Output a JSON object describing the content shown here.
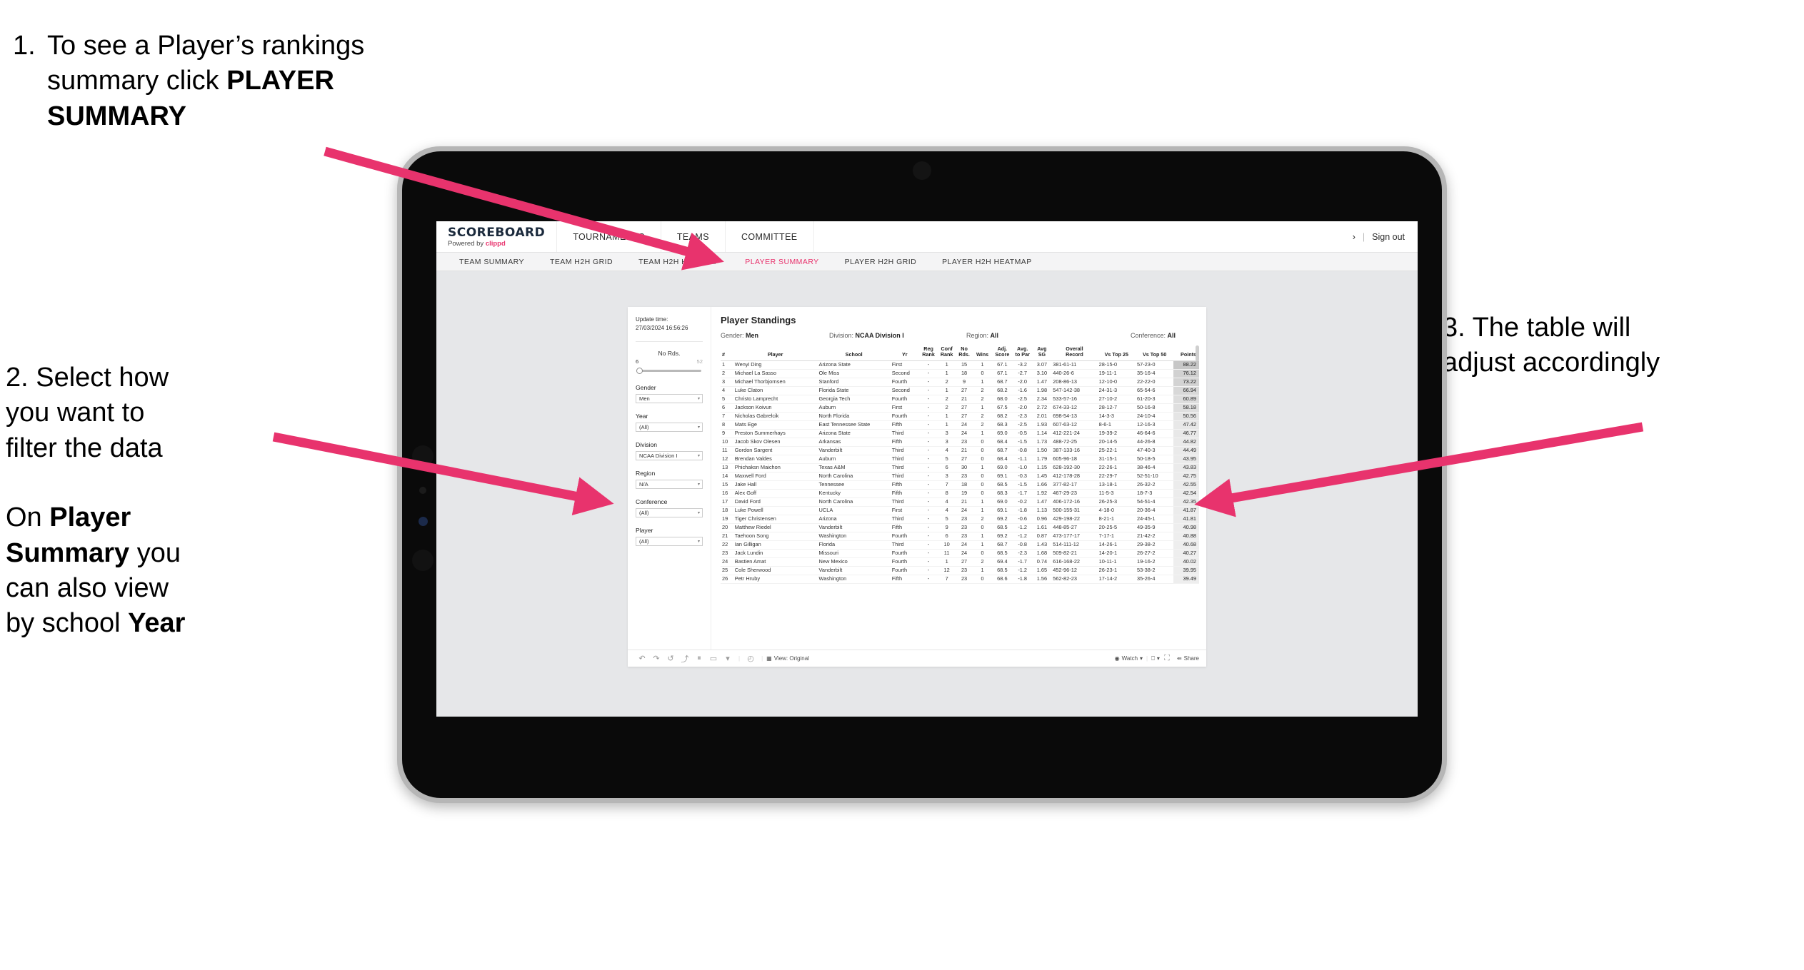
{
  "annotations": {
    "a1_number": "1.",
    "a1_line1": "To see a Player’s rankings",
    "a1_line2_pre": "summary click ",
    "a1_line2_bold": "PLAYER",
    "a1_line3_bold": "SUMMARY",
    "a2_line1": "2. Select how",
    "a2_line2": "you want to",
    "a2_line3": "filter the data",
    "a2b_pre": "On ",
    "a2b_bold1": "Player",
    "a2b_bold2": "Summary",
    "a2b_mid": " you",
    "a2b_line3": "can also view",
    "a2b_line4_pre": "by school ",
    "a2b_bold3": "Year",
    "a3_line1": "3. The table will",
    "a3_line2": "adjust accordingly"
  },
  "app": {
    "logo_main": "SCOREBOARD",
    "logo_sub_pre": "Powered by ",
    "logo_brand": "clippd",
    "topnav": [
      "TOURNAMENTS",
      "TEAMS",
      "COMMITTEE"
    ],
    "account_glyph": "›",
    "sign_out": "Sign out",
    "subnav": [
      {
        "label": "TEAM SUMMARY",
        "active": false
      },
      {
        "label": "TEAM H2H GRID",
        "active": false
      },
      {
        "label": "TEAM H2H HEATMAP",
        "active": false
      },
      {
        "label": "PLAYER SUMMARY",
        "active": true
      },
      {
        "label": "PLAYER H2H GRID",
        "active": false
      },
      {
        "label": "PLAYER H2H HEATMAP",
        "active": false
      }
    ],
    "accent_color": "#e8336d"
  },
  "filters": {
    "update_time_label": "Update time:",
    "update_time_value": "27/03/2024 16:56:26",
    "no_rds": {
      "label": "No Rds.",
      "min": "6",
      "max": "52"
    },
    "selects": [
      {
        "label": "Gender",
        "value": "Men"
      },
      {
        "label": "Year",
        "value": "(All)"
      },
      {
        "label": "Division",
        "value": "NCAA Division I"
      },
      {
        "label": "Region",
        "value": "N/A"
      },
      {
        "label": "Conference",
        "value": "(All)"
      },
      {
        "label": "Player",
        "value": "(All)"
      }
    ]
  },
  "viz": {
    "title": "Player Standings",
    "meta": [
      {
        "label": "Gender: ",
        "value": "Men"
      },
      {
        "label": "Division: ",
        "value": "NCAA Division I"
      },
      {
        "label": "Region: ",
        "value": "All"
      },
      {
        "label": "Conference: ",
        "value": "All"
      }
    ],
    "columns": [
      {
        "l1": "#",
        "l2": ""
      },
      {
        "l1": "Player",
        "l2": ""
      },
      {
        "l1": "School",
        "l2": ""
      },
      {
        "l1": "Yr",
        "l2": ""
      },
      {
        "l1": "Reg",
        "l2": "Rank"
      },
      {
        "l1": "Conf",
        "l2": "Rank"
      },
      {
        "l1": "No",
        "l2": "Rds."
      },
      {
        "l1": "Wins",
        "l2": ""
      },
      {
        "l1": "Adj.",
        "l2": "Score"
      },
      {
        "l1": "Avg.",
        "l2": "to Par"
      },
      {
        "l1": "Avg",
        "l2": "SG"
      },
      {
        "l1": "Overall",
        "l2": "Record"
      },
      {
        "l1": "Vs Top 25",
        "l2": ""
      },
      {
        "l1": "Vs Top 50",
        "l2": ""
      },
      {
        "l1": "Points",
        "l2": ""
      }
    ],
    "rows": [
      [
        "1",
        "Wenyi Ding",
        "Arizona State",
        "First",
        "-",
        "1",
        "15",
        "1",
        "67.1",
        "-3.2",
        "3.07",
        "381-61-11",
        "28-15-0",
        "57-23-0",
        "88.22"
      ],
      [
        "2",
        "Michael La Sasso",
        "Ole Miss",
        "Second",
        "-",
        "1",
        "18",
        "0",
        "67.1",
        "-2.7",
        "3.10",
        "440-26-6",
        "19-11-1",
        "35-16-4",
        "76.12"
      ],
      [
        "3",
        "Michael Thorbjornsen",
        "Stanford",
        "Fourth",
        "-",
        "2",
        "9",
        "1",
        "68.7",
        "-2.0",
        "1.47",
        "208-86-13",
        "12-10-0",
        "22-22-0",
        "73.22"
      ],
      [
        "4",
        "Luke Claton",
        "Florida State",
        "Second",
        "-",
        "1",
        "27",
        "2",
        "68.2",
        "-1.6",
        "1.98",
        "547-142-38",
        "24-31-3",
        "65-54-6",
        "66.94"
      ],
      [
        "5",
        "Christo Lamprecht",
        "Georgia Tech",
        "Fourth",
        "-",
        "2",
        "21",
        "2",
        "68.0",
        "-2.5",
        "2.34",
        "533-57-16",
        "27-10-2",
        "61-20-3",
        "60.89"
      ],
      [
        "6",
        "Jackson Koivun",
        "Auburn",
        "First",
        "-",
        "2",
        "27",
        "1",
        "67.5",
        "-2.0",
        "2.72",
        "674-33-12",
        "28-12-7",
        "50-16-8",
        "58.18"
      ],
      [
        "7",
        "Nicholas Gabrelcik",
        "North Florida",
        "Fourth",
        "-",
        "1",
        "27",
        "2",
        "68.2",
        "-2.3",
        "2.01",
        "698-54-13",
        "14-3-3",
        "24-10-4",
        "50.56"
      ],
      [
        "8",
        "Mats Ege",
        "East Tennessee State",
        "Fifth",
        "-",
        "1",
        "24",
        "2",
        "68.3",
        "-2.5",
        "1.93",
        "607-63-12",
        "8-6-1",
        "12-16-3",
        "47.42"
      ],
      [
        "9",
        "Preston Summerhays",
        "Arizona State",
        "Third",
        "-",
        "3",
        "24",
        "1",
        "69.0",
        "-0.5",
        "1.14",
        "412-221-24",
        "19-39-2",
        "46-64-6",
        "46.77"
      ],
      [
        "10",
        "Jacob Skov Olesen",
        "Arkansas",
        "Fifth",
        "-",
        "3",
        "23",
        "0",
        "68.4",
        "-1.5",
        "1.73",
        "488-72-25",
        "20-14-5",
        "44-26-8",
        "44.82"
      ],
      [
        "11",
        "Gordon Sargent",
        "Vanderbilt",
        "Third",
        "-",
        "4",
        "21",
        "0",
        "68.7",
        "-0.8",
        "1.50",
        "387-133-16",
        "25-22-1",
        "47-40-3",
        "44.49"
      ],
      [
        "12",
        "Brendan Valdes",
        "Auburn",
        "Third",
        "-",
        "5",
        "27",
        "0",
        "68.4",
        "-1.1",
        "1.79",
        "605-96-18",
        "31-15-1",
        "50-18-5",
        "43.95"
      ],
      [
        "13",
        "Phichaksn Maichon",
        "Texas A&M",
        "Third",
        "-",
        "6",
        "30",
        "1",
        "69.0",
        "-1.0",
        "1.15",
        "628-192-30",
        "22-26-1",
        "38-46-4",
        "43.83"
      ],
      [
        "14",
        "Maxwell Ford",
        "North Carolina",
        "Third",
        "-",
        "3",
        "23",
        "0",
        "69.1",
        "-0.3",
        "1.45",
        "412-178-28",
        "22-29-7",
        "52-51-10",
        "42.75"
      ],
      [
        "15",
        "Jake Hall",
        "Tennessee",
        "Fifth",
        "-",
        "7",
        "18",
        "0",
        "68.5",
        "-1.5",
        "1.66",
        "377-82-17",
        "13-18-1",
        "26-32-2",
        "42.55"
      ],
      [
        "16",
        "Alex Goff",
        "Kentucky",
        "Fifth",
        "-",
        "8",
        "19",
        "0",
        "68.3",
        "-1.7",
        "1.92",
        "467-29-23",
        "11-5-3",
        "18-7-3",
        "42.54"
      ],
      [
        "17",
        "David Ford",
        "North Carolina",
        "Third",
        "-",
        "4",
        "21",
        "1",
        "69.0",
        "-0.2",
        "1.47",
        "406-172-16",
        "26-25-3",
        "54-51-4",
        "42.35"
      ],
      [
        "18",
        "Luke Powell",
        "UCLA",
        "First",
        "-",
        "4",
        "24",
        "1",
        "69.1",
        "-1.8",
        "1.13",
        "500-155-31",
        "4-18-0",
        "20-36-4",
        "41.87"
      ],
      [
        "19",
        "Tiger Christensen",
        "Arizona",
        "Third",
        "-",
        "5",
        "23",
        "2",
        "69.2",
        "-0.6",
        "0.96",
        "429-198-22",
        "8-21-1",
        "24-45-1",
        "41.81"
      ],
      [
        "20",
        "Matthew Riedel",
        "Vanderbilt",
        "Fifth",
        "-",
        "9",
        "23",
        "0",
        "68.5",
        "-1.2",
        "1.61",
        "448-85-27",
        "20-25-5",
        "49-35-9",
        "40.98"
      ],
      [
        "21",
        "Taehoon Song",
        "Washington",
        "Fourth",
        "-",
        "6",
        "23",
        "1",
        "69.2",
        "-1.2",
        "0.87",
        "473-177-17",
        "7-17-1",
        "21-42-2",
        "40.88"
      ],
      [
        "22",
        "Ian Gilligan",
        "Florida",
        "Third",
        "-",
        "10",
        "24",
        "1",
        "68.7",
        "-0.8",
        "1.43",
        "514-111-12",
        "14-26-1",
        "29-38-2",
        "40.68"
      ],
      [
        "23",
        "Jack Lundin",
        "Missouri",
        "Fourth",
        "-",
        "11",
        "24",
        "0",
        "68.5",
        "-2.3",
        "1.68",
        "509-82-21",
        "14-20-1",
        "26-27-2",
        "40.27"
      ],
      [
        "24",
        "Bastien Amat",
        "New Mexico",
        "Fourth",
        "-",
        "1",
        "27",
        "2",
        "69.4",
        "-1.7",
        "0.74",
        "616-168-22",
        "10-11-1",
        "19-16-2",
        "40.02"
      ],
      [
        "25",
        "Cole Sherwood",
        "Vanderbilt",
        "Fourth",
        "-",
        "12",
        "23",
        "1",
        "68.5",
        "-1.2",
        "1.65",
        "452-96-12",
        "26-23-1",
        "53-38-2",
        "39.95"
      ],
      [
        "26",
        "Petr Hruby",
        "Washington",
        "Fifth",
        "-",
        "7",
        "23",
        "0",
        "68.6",
        "-1.8",
        "1.56",
        "562-82-23",
        "17-14-2",
        "35-26-4",
        "39.49"
      ]
    ]
  },
  "toolbar": {
    "icons": [
      "undo-icon",
      "redo-icon",
      "revert-icon",
      "refresh-icon",
      "pause-icon",
      "device-icon",
      "device-caret-icon",
      "history-icon"
    ],
    "glyphs": [
      "↶",
      "↷",
      "↺",
      "⤴",
      "⏸",
      "▭",
      "▾",
      "◴"
    ],
    "view_label": "View: Original",
    "watch_label": "Watch",
    "watch_caret": "▾",
    "download_caret": "▾",
    "share_label": "Share"
  }
}
